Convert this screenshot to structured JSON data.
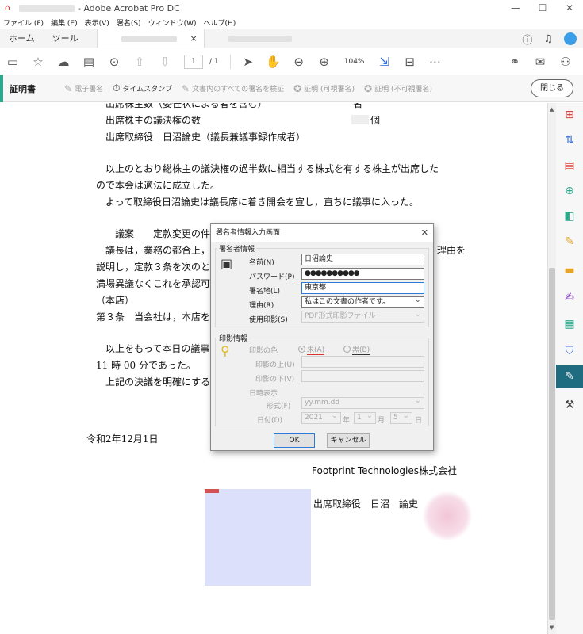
{
  "titlebar": {
    "app_title": "- Adobe Acrobat Pro DC",
    "minimize": "—",
    "maximize": "☐",
    "close": "✕"
  },
  "menubar": [
    "ファイル (F)",
    "編集 (E)",
    "表示(V)",
    "署名(S)",
    "ウィンドウ(W)",
    "ヘルプ(H)"
  ],
  "tabs": {
    "home": "ホーム",
    "tools": "ツール",
    "doc_close": "×"
  },
  "toolbar": {
    "page_current": "1",
    "page_total": "/ 1",
    "zoom": "104%"
  },
  "certbar": {
    "title": "証明書",
    "items": [
      "電子署名",
      "タイムスタンプ",
      "文書内のすべての署名を検証",
      "証明 (可視署名)",
      "証明 (不可視署名)"
    ],
    "close": "閉じる"
  },
  "document": {
    "lines": [
      "出席株主数（委任状による者を含む）",
      "名",
      "出席株主の議決権の数",
      "個",
      "出席取締役　日沼論史（議長兼議事録作成者）",
      "以上のとおり総株主の議決権の過半数に相当する株式を有する株主が出席した",
      "ので本会は適法に成立した。",
      "よって取締役日沼論史は議長席に着き開会を宣し，直ちに議事に入った。",
      "議案　　定款変更の件",
      "議長は，業務の都合上，",
      "理由を",
      "説明し，定款３条を次のと",
      "満場異議なくこれを承認可",
      "（本店）",
      "第３条　当会社は，本店を",
      "以上をもって本日の議事",
      "11 時 00 分であった。",
      "上記の決議を明確にする",
      "令和2年12月1日",
      "Footprint Technologies株式会社",
      "出席取締役　日沼　論史"
    ]
  },
  "dialog": {
    "title": "署名者情報入力画面",
    "close": "✕",
    "signer_group": "署名者情報",
    "name_label": "名前(N)",
    "name_value": "日沼論史",
    "password_label": "パスワード(P)",
    "password_value": "●●●●●●●●●●",
    "location_label": "署名地(L)",
    "location_value": "東京都",
    "reason_label": "理由(R)",
    "reason_value": "私はこの文書の作者です。",
    "stamp_label": "使用印影(S)",
    "stamp_value": "PDF形式印影ファイル",
    "seal_group": "印影情報",
    "color_label": "印影の色",
    "color_red": "朱(A)",
    "color_black": "黒(B)",
    "above_label": "印影の上(U)",
    "below_label": "印影の下(V)",
    "date_display_label": "日時表示",
    "format_label": "形式(F)",
    "format_value": "yy.mm.dd",
    "date_label": "日付(D)",
    "year_value": "2021",
    "year_unit": "年",
    "month_value": "1",
    "month_unit": "月",
    "day_value": "5",
    "day_unit": "日",
    "ok": "OK",
    "cancel": "キャンセル"
  },
  "colors": {
    "accent": "#2ea88c",
    "right_pane_active": "#1f6b80",
    "signature_box": "#dde0fa"
  }
}
